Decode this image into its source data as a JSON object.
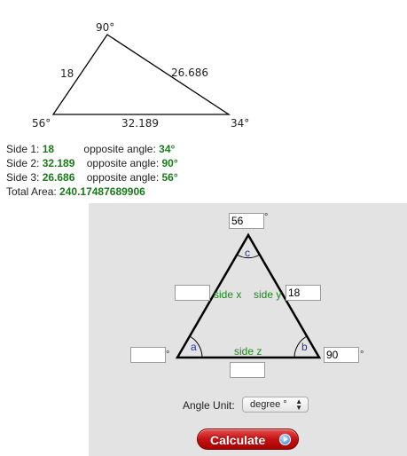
{
  "result_figure": {
    "top_angle": "90°",
    "left_angle": "56°",
    "right_angle": "34°",
    "left_side": "18",
    "right_side": "26.686",
    "bottom_side": "32.189"
  },
  "results": {
    "rows": [
      {
        "label": "Side 1:",
        "value": "18",
        "opp_label": "opposite angle:",
        "opp_value": "34°"
      },
      {
        "label": "Side 2:",
        "value": "32.189",
        "opp_label": "opposite angle:",
        "opp_value": "90°"
      },
      {
        "label": "Side 3:",
        "value": "26.686",
        "opp_label": "opposite angle:",
        "opp_value": "56°"
      }
    ],
    "area_label": "Total Area:",
    "area_value": "240.17487689906"
  },
  "calculator": {
    "angle_c_value": "56",
    "angle_a_value": "",
    "angle_b_value": "90",
    "side_x_value": "",
    "side_y_value": "18",
    "side_z_value": "",
    "degree_mark": "°",
    "label_c": "c",
    "label_a": "a",
    "label_b": "b",
    "label_side_x": "side x",
    "label_side_y": "side y",
    "label_side_z": "side z",
    "angle_unit_label": "Angle Unit:",
    "angle_unit_selected": "degree °",
    "calculate_label": "Calculate"
  },
  "colors": {
    "green": "#1a8a1a",
    "blue": "#2233aa",
    "button_red": "#c41212",
    "panel_bg": "#e3e3e3"
  }
}
